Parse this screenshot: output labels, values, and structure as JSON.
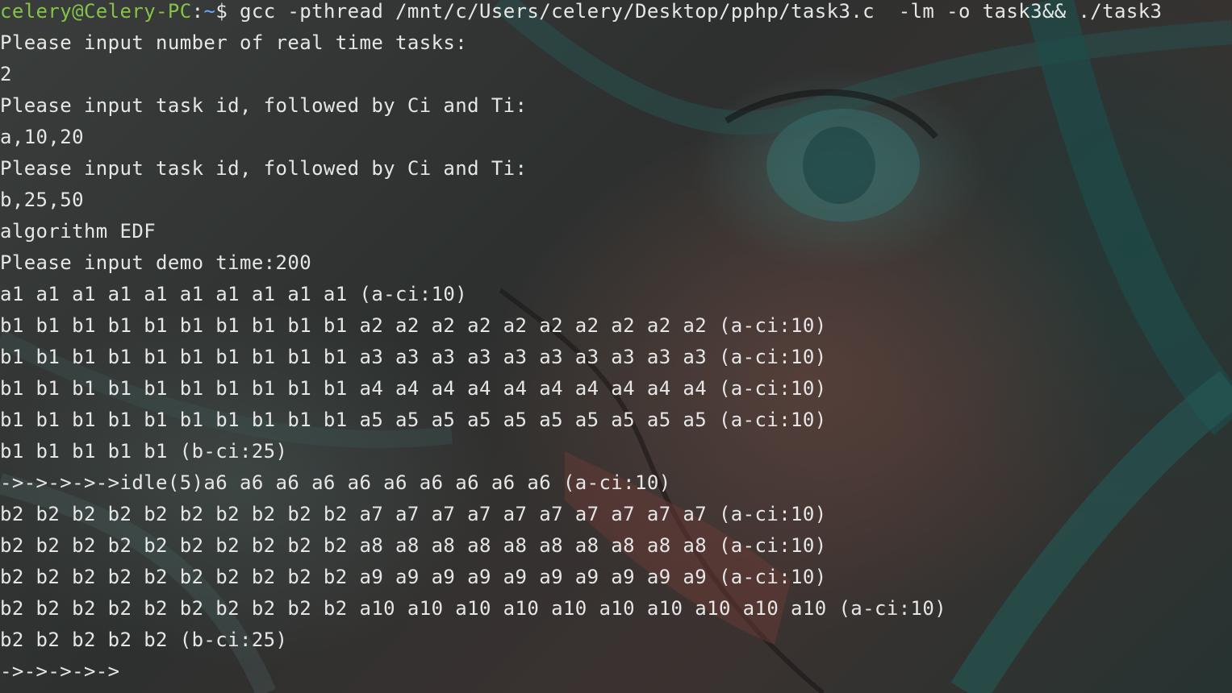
{
  "colors": {
    "prompt_user": "#86c24a",
    "prompt_path": "#6aa8ff",
    "text": "#e6e6e6",
    "background": "#2b2d2c"
  },
  "prompt": {
    "user": "celery@Celery-PC",
    "separator": ":",
    "path": "~",
    "symbol": "$ ",
    "command": "gcc -pthread /mnt/c/Users/celery/Desktop/pphp/task3.c  -lm -o task3&& ./task3"
  },
  "output": [
    "Please input number of real time tasks:",
    "2",
    "Please input task id, followed by Ci and Ti:",
    "a,10,20",
    "Please input task id, followed by Ci and Ti:",
    "b,25,50",
    "algorithm EDF",
    "Please input demo time:200",
    "a1 a1 a1 a1 a1 a1 a1 a1 a1 a1 (a-ci:10)",
    "b1 b1 b1 b1 b1 b1 b1 b1 b1 b1 a2 a2 a2 a2 a2 a2 a2 a2 a2 a2 (a-ci:10)",
    "b1 b1 b1 b1 b1 b1 b1 b1 b1 b1 a3 a3 a3 a3 a3 a3 a3 a3 a3 a3 (a-ci:10)",
    "b1 b1 b1 b1 b1 b1 b1 b1 b1 b1 a4 a4 a4 a4 a4 a4 a4 a4 a4 a4 (a-ci:10)",
    "b1 b1 b1 b1 b1 b1 b1 b1 b1 b1 a5 a5 a5 a5 a5 a5 a5 a5 a5 a5 (a-ci:10)",
    "b1 b1 b1 b1 b1 (b-ci:25)",
    "->->->->->idle(5)a6 a6 a6 a6 a6 a6 a6 a6 a6 a6 (a-ci:10)",
    "b2 b2 b2 b2 b2 b2 b2 b2 b2 b2 a7 a7 a7 a7 a7 a7 a7 a7 a7 a7 (a-ci:10)",
    "b2 b2 b2 b2 b2 b2 b2 b2 b2 b2 a8 a8 a8 a8 a8 a8 a8 a8 a8 a8 (a-ci:10)",
    "b2 b2 b2 b2 b2 b2 b2 b2 b2 b2 a9 a9 a9 a9 a9 a9 a9 a9 a9 a9 (a-ci:10)",
    "b2 b2 b2 b2 b2 b2 b2 b2 b2 b2 a10 a10 a10 a10 a10 a10 a10 a10 a10 a10 (a-ci:10)",
    "b2 b2 b2 b2 b2 (b-ci:25)",
    "->->->->->"
  ]
}
